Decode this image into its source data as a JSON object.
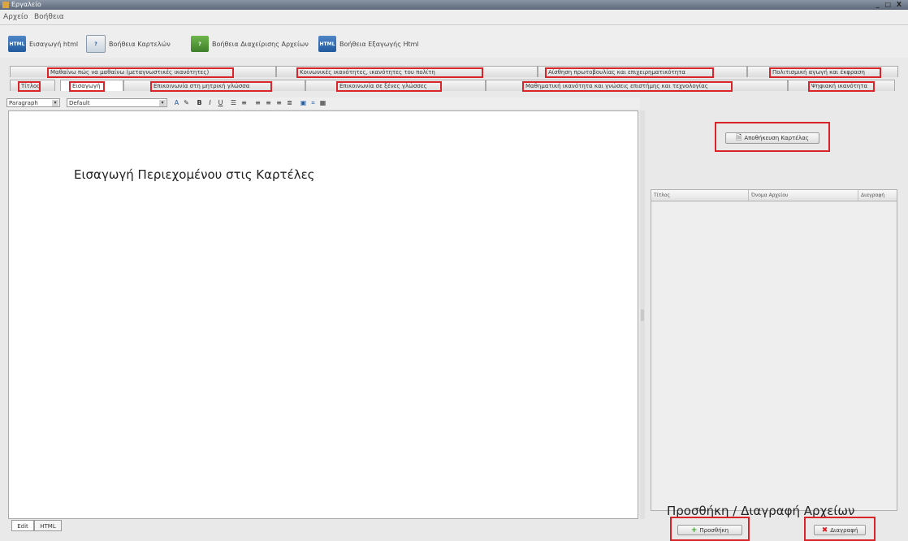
{
  "window": {
    "title": "Εργαλείο",
    "controls": "_ □ X"
  },
  "menu": [
    "Αρχείο",
    "Βοήθεια"
  ],
  "toolbar": [
    {
      "label": "Εισαγωγή html",
      "icon": "html-import-icon"
    },
    {
      "label": "Βοήθεια Καρτελών",
      "icon": "help-document-icon"
    },
    {
      "label": "Βοήθεια Διαχείρισης Αρχείων",
      "icon": "file-manager-help-icon"
    },
    {
      "label": "Βοήθεια Εξαγωγής Html",
      "icon": "html-export-icon"
    }
  ],
  "tabs": {
    "row1": [
      "Μαθαίνω πώς να μαθαίνω (μεταγνωστικές ικανότητες)",
      "Κοινωνικές ικανότητες, ικανότητες του πολίτη",
      "Αίσθηση πρωτοβουλίας και επιχειρηματικότητα",
      "Πολιτισμική αγωγή και έκφραση"
    ],
    "row2": [
      "Τίτλος",
      "Εισαγωγή",
      "Επικοινωνία στη μητρική γλώσσα",
      "Επικοινωνία σε ξένες γλώσσες",
      "Μαθηματική ικανότητα και γνώσεις επιστήμης και τεχνολογίας",
      "Ψηφιακή ικανότητα"
    ]
  },
  "format": {
    "paragraph": "Paragraph",
    "font": "Default",
    "icons": [
      "font-color-icon",
      "highlight-icon",
      "bold-icon",
      "italic-icon",
      "underline-icon",
      "bullet-list-icon",
      "numbered-list-icon",
      "align-left-icon",
      "align-center-icon",
      "align-right-icon",
      "justify-icon",
      "image-icon",
      "link-icon",
      "table-icon"
    ],
    "bold": "B",
    "italic": "I",
    "underline": "U"
  },
  "editor": {
    "caption": "Εισαγωγή Περιεχομένου στις Καρτέλες"
  },
  "modes": [
    "Edit",
    "HTML"
  ],
  "right": {
    "save_button": "Αποθήκευση Καρτέλας",
    "columns": [
      "Τίτλος",
      "Όνομα Αρχείου",
      "Διαγραφή"
    ],
    "caption": "Προσθήκη / Διαγραφή Αρχείων",
    "add_button": "Προσθήκη",
    "delete_button": "Διαγραφή"
  },
  "colors": {
    "highlight": "#d9242a"
  }
}
